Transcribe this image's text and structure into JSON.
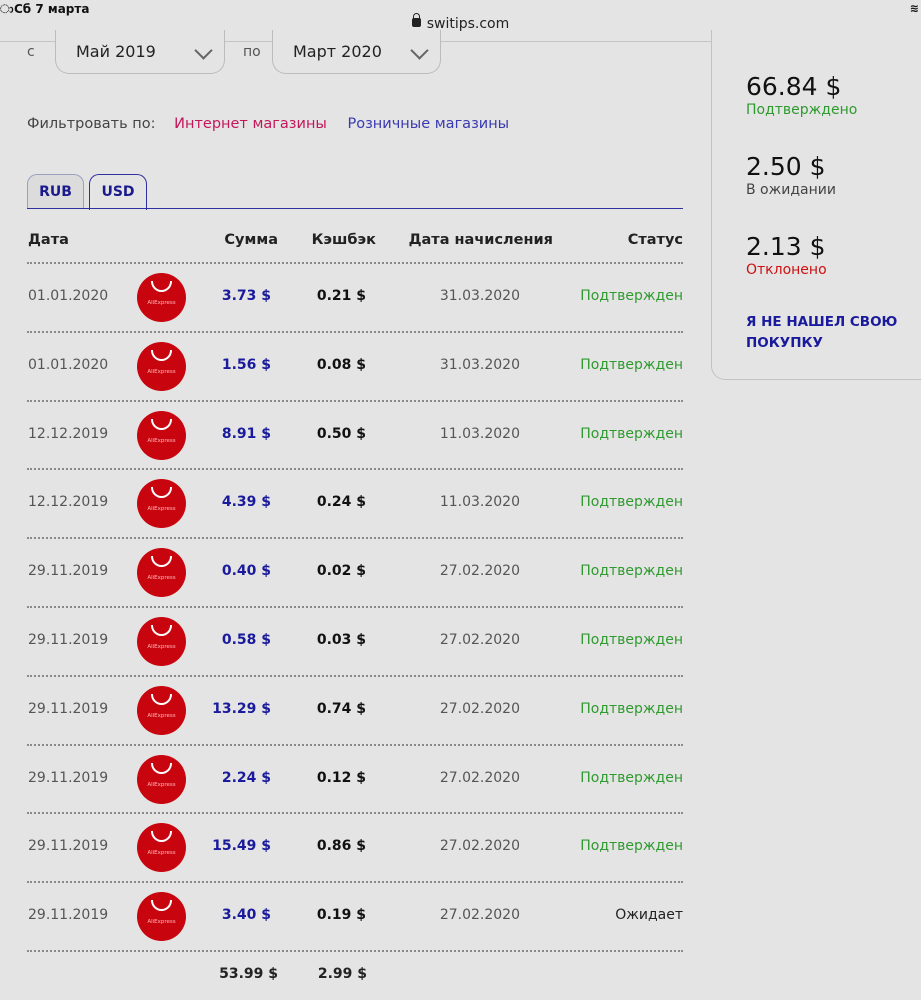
{
  "statusbar": {
    "time": "Сб 7 марта",
    "corner": "ා",
    "wifi": "≋"
  },
  "browser": {
    "url": "switips.com"
  },
  "date_range": {
    "from_label": "с",
    "from_value": "Май 2019",
    "to_label": "по",
    "to_value": "Март 2020"
  },
  "filter": {
    "label": "Фильтровать по:",
    "online": "Интернет магазины",
    "retail": "Розничные магазины"
  },
  "tabs": [
    {
      "label": "RUB",
      "active": false
    },
    {
      "label": "USD",
      "active": true
    }
  ],
  "table": {
    "headers": {
      "date": "Дата",
      "amount": "Сумма",
      "cashback": "Кэшбэк",
      "credit_date": "Дата начисления",
      "status": "Статус"
    },
    "rows": [
      {
        "date": "01.01.2020",
        "store": "AliExpress",
        "amount": "3.73 $",
        "cashback": "0.21 $",
        "credit_date": "31.03.2020",
        "status": "Подтвержден"
      },
      {
        "date": "01.01.2020",
        "store": "AliExpress",
        "amount": "1.56 $",
        "cashback": "0.08 $",
        "credit_date": "31.03.2020",
        "status": "Подтвержден"
      },
      {
        "date": "12.12.2019",
        "store": "AliExpress",
        "amount": "8.91 $",
        "cashback": "0.50 $",
        "credit_date": "11.03.2020",
        "status": "Подтвержден"
      },
      {
        "date": "12.12.2019",
        "store": "AliExpress",
        "amount": "4.39 $",
        "cashback": "0.24 $",
        "credit_date": "11.03.2020",
        "status": "Подтвержден"
      },
      {
        "date": "29.11.2019",
        "store": "AliExpress",
        "amount": "0.40 $",
        "cashback": "0.02 $",
        "credit_date": "27.02.2020",
        "status": "Подтвержден"
      },
      {
        "date": "29.11.2019",
        "store": "AliExpress",
        "amount": "0.58 $",
        "cashback": "0.03 $",
        "credit_date": "27.02.2020",
        "status": "Подтвержден"
      },
      {
        "date": "29.11.2019",
        "store": "AliExpress",
        "amount": "13.29 $",
        "cashback": "0.74 $",
        "credit_date": "27.02.2020",
        "status": "Подтвержден"
      },
      {
        "date": "29.11.2019",
        "store": "AliExpress",
        "amount": "2.24 $",
        "cashback": "0.12 $",
        "credit_date": "27.02.2020",
        "status": "Подтвержден"
      },
      {
        "date": "29.11.2019",
        "store": "AliExpress",
        "amount": "15.49 $",
        "cashback": "0.86 $",
        "credit_date": "27.02.2020",
        "status": "Подтвержден"
      },
      {
        "date": "29.11.2019",
        "store": "AliExpress",
        "amount": "3.40 $",
        "cashback": "0.19 $",
        "credit_date": "27.02.2020",
        "status": "Ожидает"
      }
    ],
    "totals": {
      "amount": "53.99 $",
      "cashback": "2.99 $"
    }
  },
  "summary": {
    "confirmed_value": "66.84 $",
    "confirmed_label": "Подтверждено",
    "pending_value": "2.50 $",
    "pending_label": "В ожидании",
    "rejected_value": "2.13 $",
    "rejected_label": "Отклонено",
    "report_link": "Я НЕ НАШЕЛ СВОЮ ПОКУПКУ"
  },
  "colors": {
    "confirmed": "#2e9a2e",
    "rejected": "#cc1010",
    "link_blue": "#1a1a9c",
    "online_pink": "#c2185b",
    "store_red": "#c8050f"
  }
}
